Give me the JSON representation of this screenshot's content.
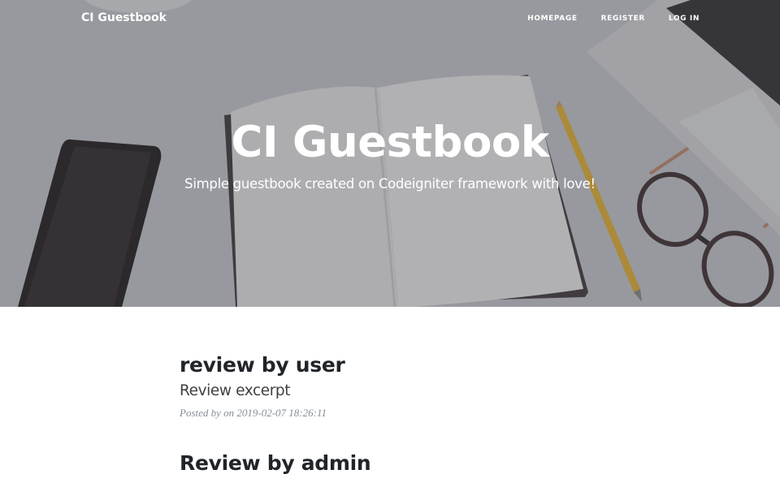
{
  "navbar": {
    "brand": "CI Guestbook",
    "links": [
      "Homepage",
      "Register",
      "Log In"
    ]
  },
  "hero": {
    "title": "CI Guestbook",
    "subtitle": "Simple guestbook created on Codeigniter framework with love!"
  },
  "posts": [
    {
      "title": "review by user",
      "subtitle": "Review excerpt",
      "meta": "Posted by  on 2019-02-07 18:26:11"
    },
    {
      "title": "Review by admin"
    }
  ],
  "colors": {
    "hero_overlay": "#46484e",
    "text_dark": "#212529",
    "meta_gray": "#868e96",
    "pencil_yellow": "#e9b42c"
  },
  "icons": [
    "phone-photo",
    "notebook-photo",
    "pencil-photo",
    "glasses-photo",
    "laptop-photo"
  ]
}
